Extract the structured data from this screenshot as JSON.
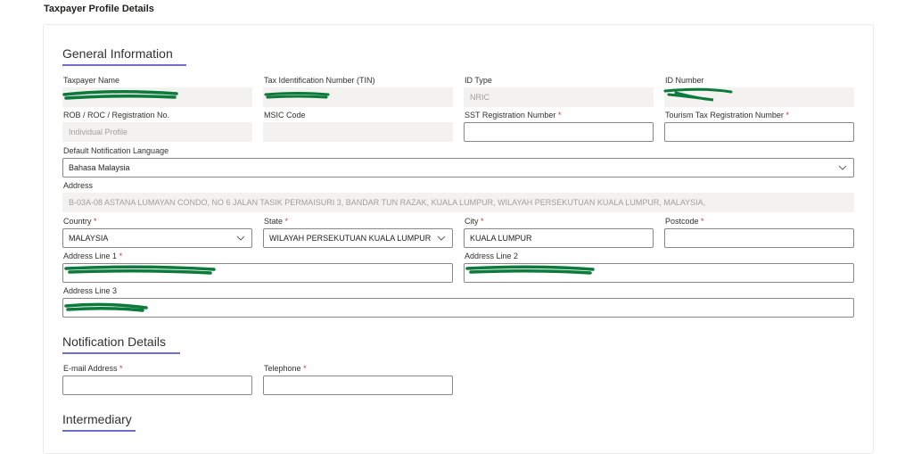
{
  "page": {
    "title": "Taxpayer Profile Details"
  },
  "sections": {
    "general": "General Information",
    "notification": "Notification Details",
    "intermediary": "Intermediary"
  },
  "fields": {
    "taxpayer_name": {
      "label": "Taxpayer Name",
      "value": ""
    },
    "tin": {
      "label": "Tax Identification Number (TIN)",
      "value": ""
    },
    "id_type": {
      "label": "ID Type",
      "value": "NRIC"
    },
    "id_number": {
      "label": "ID Number",
      "value": ""
    },
    "rob": {
      "label": "ROB / ROC / Registration No.",
      "value": "Individual Profile"
    },
    "msic": {
      "label": "MSIC Code",
      "value": ""
    },
    "sst": {
      "label": "SST Registration Number",
      "required": "*",
      "value": ""
    },
    "tourism": {
      "label": "Tourism Tax Registration Number",
      "required": "*",
      "value": ""
    },
    "language": {
      "label": "Default Notification Language",
      "value": "Bahasa Malaysia"
    },
    "address": {
      "label": "Address",
      "value": "B-03A-08 ASTANA LUMAYAN CONDO, NO 6 JALAN TASIK PERMAISURI 3, BANDAR TUN RAZAK, KUALA LUMPUR, WILAYAH PERSEKUTUAN KUALA LUMPUR, MALAYSIA,"
    },
    "country": {
      "label": "Country",
      "required": "*",
      "value": "MALAYSIA"
    },
    "state": {
      "label": "State",
      "required": "*",
      "value": "WILAYAH PERSEKUTUAN KUALA LUMPUR"
    },
    "city": {
      "label": "City",
      "required": "*",
      "value": "KUALA LUMPUR"
    },
    "postcode": {
      "label": "Postcode",
      "required": "*",
      "value": ""
    },
    "address1": {
      "label": "Address Line 1",
      "required": "*",
      "value": ""
    },
    "address2": {
      "label": "Address Line 2",
      "value": ""
    },
    "address3": {
      "label": "Address Line 3",
      "value": ""
    },
    "email": {
      "label": "E-mail Address",
      "required": "*",
      "value": ""
    },
    "telephone": {
      "label": "Telephone",
      "required": "*",
      "value": ""
    }
  },
  "colors": {
    "accent": "#6f6fc9",
    "required": "#d13438",
    "redaction": "#0b7a3b"
  }
}
